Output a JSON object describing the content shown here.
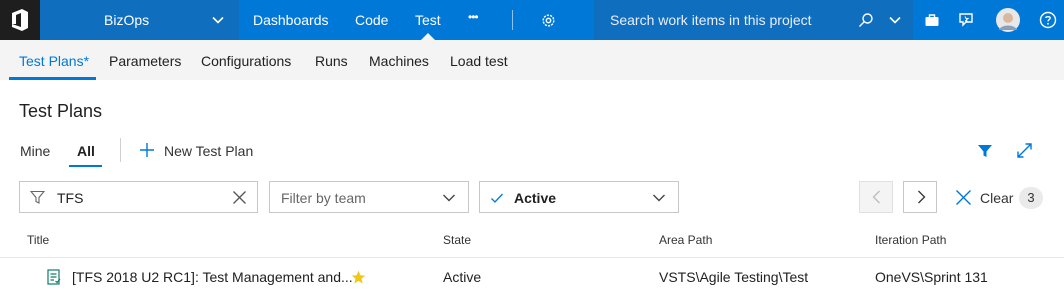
{
  "topbar": {
    "project_name": "BizOps",
    "nav": [
      {
        "label": "Dashboards"
      },
      {
        "label": "Code"
      },
      {
        "label": "Test"
      }
    ],
    "more_label": "•••",
    "search_placeholder": "Search work items in this project",
    "accent_color": "#0078d7"
  },
  "subnav": {
    "tabs": [
      {
        "label": "Test Plans*"
      },
      {
        "label": "Parameters"
      },
      {
        "label": "Configurations"
      },
      {
        "label": "Runs"
      },
      {
        "label": "Machines"
      },
      {
        "label": "Load test"
      }
    ]
  },
  "page": {
    "title": "Test Plans",
    "pivots": [
      {
        "label": "Mine"
      },
      {
        "label": "All"
      }
    ],
    "new_plan_label": "New Test Plan"
  },
  "filters": {
    "keyword_value": "TFS",
    "team_placeholder": "Filter by team",
    "state_value": "Active",
    "clear_label": "Clear",
    "count": "3"
  },
  "table": {
    "columns": [
      "Title",
      "State",
      "Area Path",
      "Iteration Path"
    ],
    "rows": [
      {
        "title": "[TFS 2018 U2 RC1]: Test Management and...",
        "state": "Active",
        "area_path": "VSTS\\Agile Testing\\Test",
        "iteration_path": "OneVS\\Sprint 131",
        "favorite": true
      }
    ]
  },
  "icons": {
    "logo": "azure-devops-logo-icon",
    "filter": "funnel-icon",
    "expand": "expand-diagonal-icon"
  }
}
